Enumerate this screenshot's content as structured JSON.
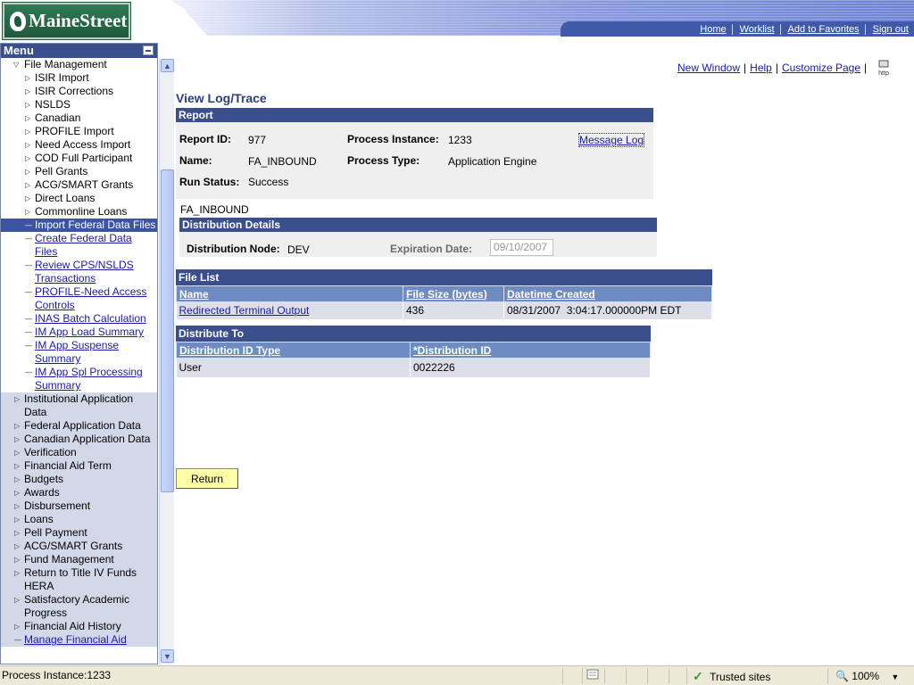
{
  "header": {
    "logo_text": "MaineStreet",
    "links": [
      "Home",
      "Worklist",
      "Add to Favorites",
      "Sign out"
    ]
  },
  "menu": {
    "title": "Menu",
    "top_items": [
      {
        "label": "File Management",
        "level": 1,
        "glyph": "open"
      },
      {
        "label": "ISIR Import",
        "level": 2,
        "glyph": "closed"
      },
      {
        "label": "ISIR Corrections",
        "level": 2,
        "glyph": "closed"
      },
      {
        "label": "NSLDS",
        "level": 2,
        "glyph": "closed"
      },
      {
        "label": "Canadian",
        "level": 2,
        "glyph": "closed"
      },
      {
        "label": "PROFILE Import",
        "level": 2,
        "glyph": "closed"
      },
      {
        "label": "Need Access Import",
        "level": 2,
        "glyph": "closed"
      },
      {
        "label": "COD Full Participant",
        "level": 2,
        "glyph": "closed"
      },
      {
        "label": "Pell Grants",
        "level": 2,
        "glyph": "closed"
      },
      {
        "label": "ACG/SMART Grants",
        "level": 2,
        "glyph": "closed"
      },
      {
        "label": "Direct Loans",
        "level": 2,
        "glyph": "closed"
      },
      {
        "label": "Commonline Loans",
        "level": 2,
        "glyph": "closed"
      },
      {
        "label": "Import Federal Data Files",
        "level": 2,
        "glyph": "dash",
        "selected": true
      },
      {
        "label": "Create Federal Data Files",
        "level": 2,
        "glyph": "dash",
        "link": true
      },
      {
        "label": "Review CPS/NSLDS Transactions",
        "level": 2,
        "glyph": "dash",
        "link": true
      },
      {
        "label": "PROFILE-Need Access Controls",
        "level": 2,
        "glyph": "dash",
        "link": true
      },
      {
        "label": "INAS Batch Calculation",
        "level": 2,
        "glyph": "dash",
        "link": true
      },
      {
        "label": "IM App Load Summary",
        "level": 2,
        "glyph": "dash",
        "link": true
      },
      {
        "label": "IM App Suspense Summary",
        "level": 2,
        "glyph": "dash",
        "link": true
      },
      {
        "label": "IM App Spl Processing Summary",
        "level": 2,
        "glyph": "dash",
        "link": true
      }
    ],
    "bottom_items": [
      {
        "label": "Institutional Application Data",
        "glyph": "closed"
      },
      {
        "label": "Federal Application Data",
        "glyph": "closed"
      },
      {
        "label": "Canadian Application Data",
        "glyph": "closed"
      },
      {
        "label": "Verification",
        "glyph": "closed"
      },
      {
        "label": "Financial Aid Term",
        "glyph": "closed"
      },
      {
        "label": "Budgets",
        "glyph": "closed"
      },
      {
        "label": "Awards",
        "glyph": "closed"
      },
      {
        "label": "Disbursement",
        "glyph": "closed"
      },
      {
        "label": "Loans",
        "glyph": "closed"
      },
      {
        "label": "Pell Payment",
        "glyph": "closed"
      },
      {
        "label": "ACG/SMART Grants",
        "glyph": "closed"
      },
      {
        "label": "Fund Management",
        "glyph": "closed"
      },
      {
        "label": "Return to Title IV Funds",
        "glyph": "closed"
      },
      {
        "label": "HERA",
        "glyph": "none"
      },
      {
        "label": "Satisfactory Academic Progress",
        "glyph": "closed"
      },
      {
        "label": "Financial Aid History",
        "glyph": "closed"
      },
      {
        "label": "Manage Financial Aid",
        "glyph": "dash",
        "link": true
      }
    ]
  },
  "page_links": {
    "new_window": "New Window",
    "help": "Help",
    "customize": "Customize Page",
    "http_icon_text": "http"
  },
  "page": {
    "title": "View Log/Trace",
    "report_section": "Report",
    "report_id_label": "Report ID:",
    "report_id": "977",
    "process_instance_label": "Process Instance:",
    "process_instance": "1233",
    "message_log": "Message Log",
    "name_label": "Name:",
    "name": "FA_INBOUND",
    "process_type_label": "Process Type:",
    "process_type": "Application Engine",
    "run_status_label": "Run Status:",
    "run_status": "Success",
    "subtitle": "FA_INBOUND",
    "distribution_section": "Distribution Details",
    "distribution_node_label": "Distribution Node:",
    "distribution_node": "DEV",
    "expiration_label": "Expiration Date:",
    "expiration_date": "09/10/2007",
    "file_list": {
      "title": "File List",
      "columns": [
        "Name",
        "File Size (bytes)",
        "Datetime Created"
      ],
      "rows": [
        [
          "Redirected Terminal Output",
          "436",
          "08/31/2007  3:04:17.000000PM EDT"
        ]
      ]
    },
    "distribute_to": {
      "title": "Distribute To",
      "columns": [
        "Distribution ID Type",
        "*Distribution ID"
      ],
      "rows": [
        [
          "User",
          "0022226"
        ]
      ]
    },
    "return_button": "Return"
  },
  "statusbar": {
    "left": "Process Instance:1233",
    "zone": "Trusted sites",
    "zoom": "100%"
  }
}
